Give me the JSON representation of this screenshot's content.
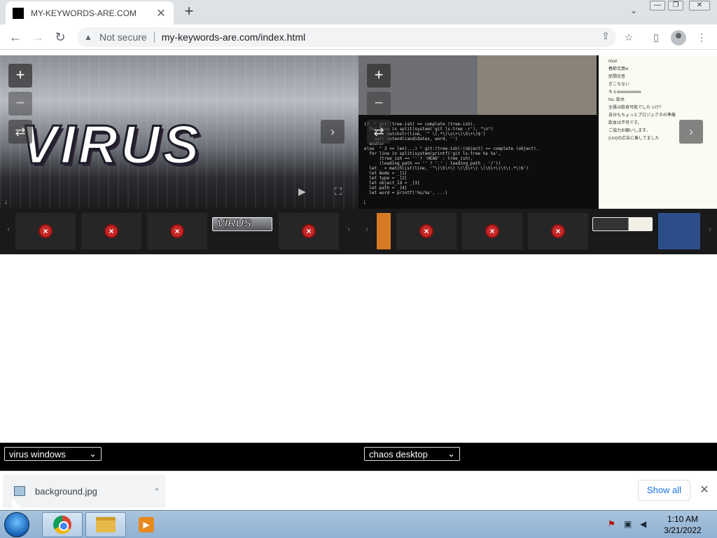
{
  "browser": {
    "tab_title": "MY-KEYWORDS-ARE.COM",
    "tab_close": "✕",
    "new_tab": "+",
    "security_label": "Not secure",
    "url": "my-keywords-are.com/index.html",
    "window_controls": {
      "minimize": "—",
      "restore": "❐",
      "close": "✕"
    },
    "icons": [
      "back-icon",
      "forward-icon",
      "reload-icon",
      "warning-icon",
      "share-icon",
      "star-icon",
      "sidepanel-icon",
      "profile-icon",
      "menu-icon"
    ]
  },
  "viewer_left": {
    "graffiti_text": "VIRUS",
    "zoom_in": "+",
    "zoom_out": "−",
    "thumbnails": [
      {
        "state": "error"
      },
      {
        "state": "error"
      },
      {
        "state": "error"
      },
      {
        "state": "selected",
        "label": "VIRUS"
      },
      {
        "state": "error"
      }
    ]
  },
  "viewer_right": {
    "zoom_in": "+",
    "zoom_out": "−",
    "terminal_lines": [
      "if  \" git:(tree-ish) == complete (tree-ish).",
      "  for line in split(system('git ls-tree -r'), \"\\n\")",
      "    call matchstr(line, '^ \\(.*\\)\\s\\+\\(\\S\\+\\)$')",
      "    call extend(candidates, word, '')",
      "  endfor",
      "else  \" 3 <= len(...) \" git:(tree-ish):(object) == complete (object).",
      "  for line in split(system(printf('git ls-tree %s %s',",
      "      (tree_ish == '' ? 'HEAD' : tree_ish),",
      "      (leading_path == '' ? '.' : leading_path . '/'))",
      "  let _ = matchlist(line, '^\\(\\S\\+\\) \\(\\S\\+\\) \\(\\S\\+\\)\\t\\(.*\\)$')",
      "  let mode = _[1]",
      "  let type = _[2]",
      "  let object_id = _[3]",
      "  let path = _[4]",
      "",
      "  let word = printf('%s/%s', ...)"
    ],
    "chat_messages": [
      "nice!",
      "春節合算w",
      "民間合意",
      "ぎこちない",
      "ちぇwwwwwwww",
      "No. 飲水",
      "全員は飲食可能でしたっけ？",
      "自分もちょっとプロジェクタの準備",
      "飲食は不可です。",
      "ご協力お願いします。",
      "(Ust)の広告に乗してました"
    ],
    "thumbnails": [
      {
        "state": "image"
      },
      {
        "state": "error"
      },
      {
        "state": "error"
      },
      {
        "state": "error"
      },
      {
        "state": "image"
      },
      {
        "state": "image"
      }
    ]
  },
  "selects": {
    "left_value": "virus windows",
    "right_value": "chaos desktop"
  },
  "downloads": {
    "file_name": "background.jpg",
    "show_all": "Show all",
    "close": "✕"
  },
  "taskbar": {
    "time": "1:10 AM",
    "date": "3/21/2022"
  }
}
